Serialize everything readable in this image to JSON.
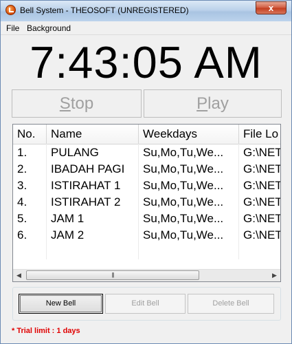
{
  "window": {
    "title": "Bell System - THEOSOFT (UNREGISTERED)",
    "close_glyph": "x"
  },
  "menu": [
    {
      "label": "File"
    },
    {
      "label": "Background"
    }
  ],
  "clock": {
    "time": "7:43:05 AM"
  },
  "controls": {
    "stop_label": "Stop",
    "play_label": "Play"
  },
  "list": {
    "columns": [
      "No.",
      "Name",
      "Weekdays",
      "File Lo"
    ],
    "rows": [
      {
        "no": "1.",
        "name": "PULANG",
        "weekdays": "Su,Mo,Tu,We...",
        "file": "G:\\NET"
      },
      {
        "no": "2.",
        "name": "IBADAH PAGI",
        "weekdays": "Su,Mo,Tu,We...",
        "file": "G:\\NET"
      },
      {
        "no": "3.",
        "name": "ISTIRAHAT 1",
        "weekdays": "Su,Mo,Tu,We...",
        "file": "G:\\NET"
      },
      {
        "no": "4.",
        "name": "ISTIRAHAT 2",
        "weekdays": "Su,Mo,Tu,We...",
        "file": "G:\\NET"
      },
      {
        "no": "5.",
        "name": "JAM 1",
        "weekdays": "Su,Mo,Tu,We...",
        "file": "G:\\NET"
      },
      {
        "no": "6.",
        "name": "JAM 2",
        "weekdays": "Su,Mo,Tu,We...",
        "file": "G:\\NET"
      }
    ]
  },
  "actions": {
    "new_label": "New Bell",
    "edit_label": "Edit Bell",
    "delete_label": "Delete Bell"
  },
  "footer": {
    "trial_text": "* Trial limit : 1 days",
    "trial_color": "#e00000"
  }
}
